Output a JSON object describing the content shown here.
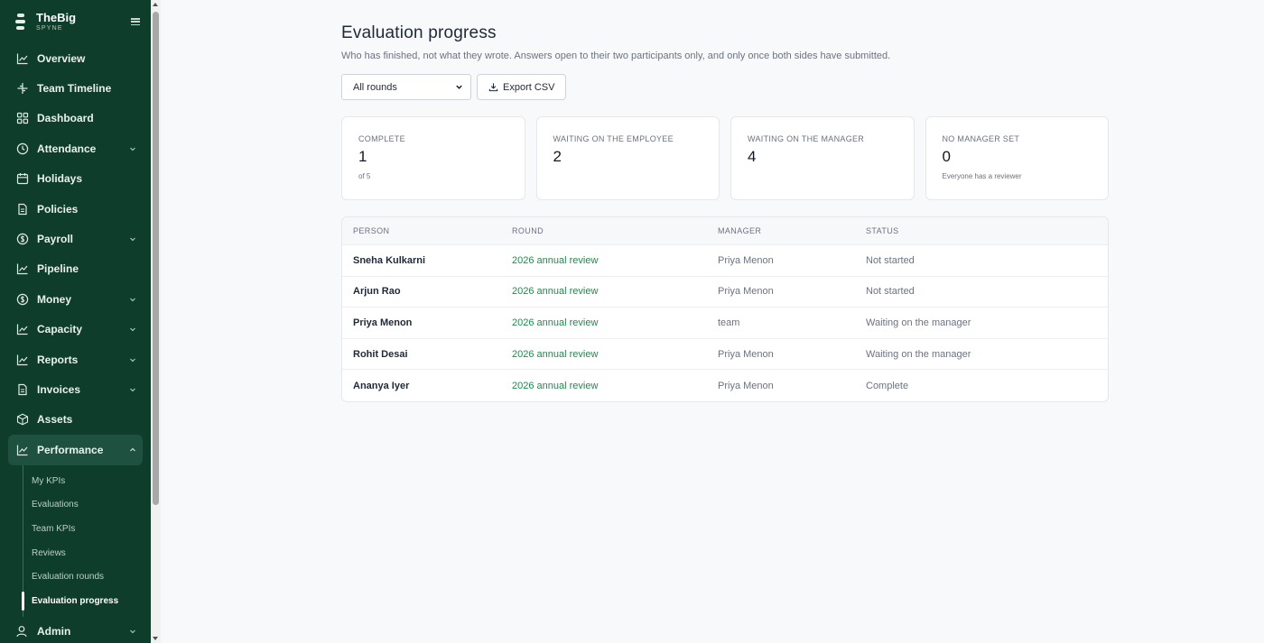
{
  "brand": {
    "name": "TheBig",
    "sub": "SPYNE"
  },
  "nav": [
    {
      "key": "overview",
      "label": "Overview",
      "icon": "trend-icon",
      "chevron": false
    },
    {
      "key": "team-timeline",
      "label": "Team Timeline",
      "icon": "timeline-icon",
      "chevron": false
    },
    {
      "key": "dashboard",
      "label": "Dashboard",
      "icon": "grid-icon",
      "chevron": false
    },
    {
      "key": "attendance",
      "label": "Attendance",
      "icon": "clock-icon",
      "chevron": true
    },
    {
      "key": "holidays",
      "label": "Holidays",
      "icon": "calendar-icon",
      "chevron": false
    },
    {
      "key": "policies",
      "label": "Policies",
      "icon": "document-icon",
      "chevron": false
    },
    {
      "key": "payroll",
      "label": "Payroll",
      "icon": "dollar-icon",
      "chevron": true
    },
    {
      "key": "pipeline",
      "label": "Pipeline",
      "icon": "trend-icon",
      "chevron": false
    },
    {
      "key": "money",
      "label": "Money",
      "icon": "dollar-icon",
      "chevron": true
    },
    {
      "key": "capacity",
      "label": "Capacity",
      "icon": "trend-icon",
      "chevron": true
    },
    {
      "key": "reports",
      "label": "Reports",
      "icon": "trend-icon",
      "chevron": true
    },
    {
      "key": "invoices",
      "label": "Invoices",
      "icon": "document-icon",
      "chevron": true
    },
    {
      "key": "assets",
      "label": "Assets",
      "icon": "box-icon",
      "chevron": false
    },
    {
      "key": "performance",
      "label": "Performance",
      "icon": "trend-icon",
      "chevron": true,
      "expanded": true
    }
  ],
  "subnav": [
    "My KPIs",
    "Evaluations",
    "Team KPIs",
    "Reviews",
    "Evaluation rounds",
    "Evaluation progress"
  ],
  "subnav_current": "Evaluation progress",
  "admin": {
    "label": "Admin",
    "icon": "user-icon"
  },
  "page": {
    "title": "Evaluation progress",
    "subtitle": "Who has finished, not what they wrote. Answers open to their two participants only, and only once both sides have submitted."
  },
  "toolbar": {
    "round_filter": "All rounds",
    "export_label": "Export CSV"
  },
  "stats": [
    {
      "label": "Complete",
      "value": "1",
      "note": "of 5"
    },
    {
      "label": "Waiting on the employee",
      "value": "2",
      "note": ""
    },
    {
      "label": "Waiting on the manager",
      "value": "4",
      "note": ""
    },
    {
      "label": "No manager set",
      "value": "0",
      "note": "Everyone has a reviewer"
    }
  ],
  "table": {
    "columns": [
      "Person",
      "Round",
      "Manager",
      "Status"
    ],
    "rows": [
      {
        "person": "Sneha Kulkarni",
        "round": "2026 annual review",
        "manager": "Priya Menon",
        "status": "Not started"
      },
      {
        "person": "Arjun Rao",
        "round": "2026 annual review",
        "manager": "Priya Menon",
        "status": "Not started"
      },
      {
        "person": "Priya Menon",
        "round": "2026 annual review",
        "manager": "team",
        "status": "Waiting on the manager"
      },
      {
        "person": "Rohit Desai",
        "round": "2026 annual review",
        "manager": "Priya Menon",
        "status": "Waiting on the manager"
      },
      {
        "person": "Ananya Iyer",
        "round": "2026 annual review",
        "manager": "Priya Menon",
        "status": "Complete"
      }
    ]
  },
  "colors": {
    "sidebar": "#0f3d2c",
    "sidebar_active": "#1e5140",
    "link": "#1e8a4c"
  }
}
